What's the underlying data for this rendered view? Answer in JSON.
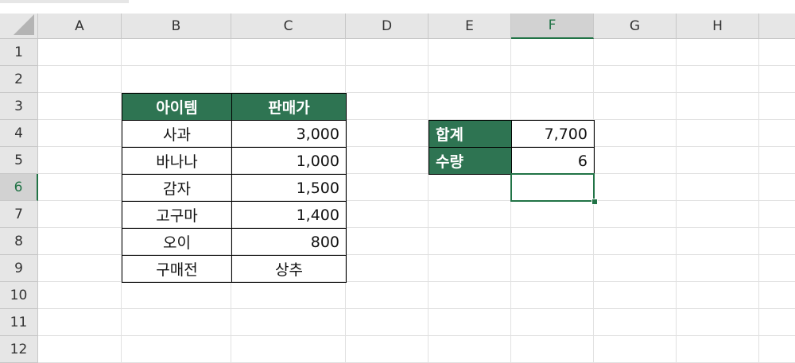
{
  "columns": [
    "A",
    "B",
    "C",
    "D",
    "E",
    "F",
    "G",
    "H"
  ],
  "rows": [
    "1",
    "2",
    "3",
    "4",
    "5",
    "6",
    "7",
    "8",
    "9",
    "10",
    "11",
    "12"
  ],
  "active": {
    "column": "F",
    "row": "6"
  },
  "table": {
    "header": [
      "아이템",
      "판매가"
    ],
    "items": [
      {
        "item": "사과",
        "price": "3,000"
      },
      {
        "item": "바나나",
        "price": "1,000"
      },
      {
        "item": "감자",
        "price": "1,500"
      },
      {
        "item": "고구마",
        "price": "1,400"
      },
      {
        "item": "오이",
        "price": "800"
      },
      {
        "item": "구매전",
        "price": "상추"
      }
    ]
  },
  "summary": {
    "total_label": "합계",
    "total_value": "7,700",
    "count_label": "수량",
    "count_value": "6"
  },
  "colors": {
    "header_fill": "#2e7452",
    "accent": "#217346"
  }
}
